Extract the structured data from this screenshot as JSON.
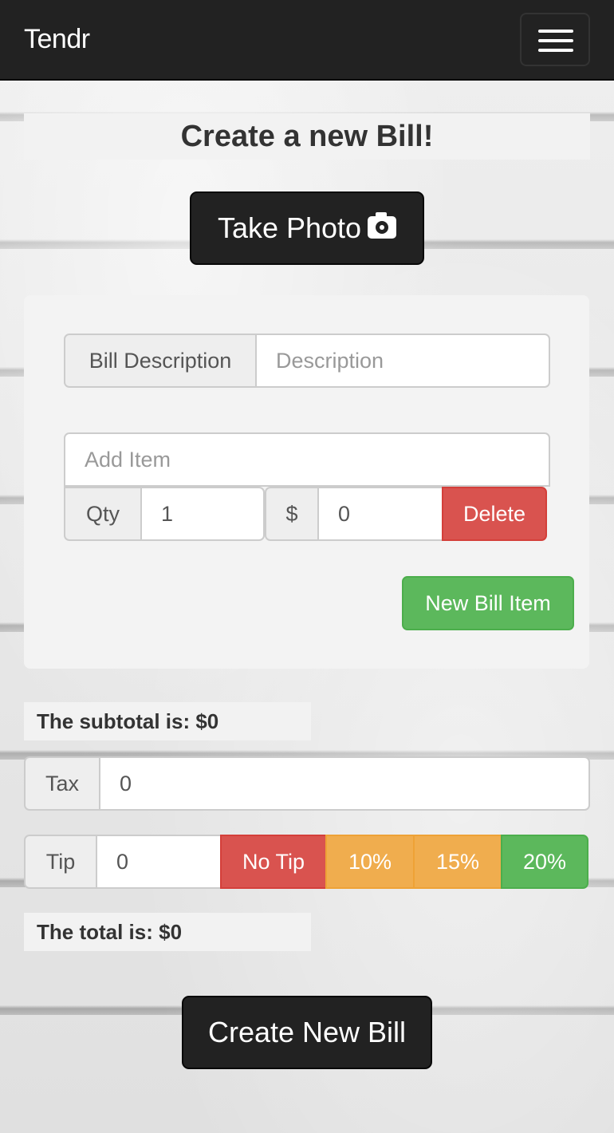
{
  "navbar": {
    "brand": "Tendr",
    "menu_icon": "hamburger-menu-icon"
  },
  "page": {
    "title": "Create a new Bill!"
  },
  "take_photo": {
    "label": "Take Photo",
    "icon": "camera-icon"
  },
  "bill_form": {
    "description_label": "Bill Description",
    "description_placeholder": "Description",
    "description_value": "",
    "item": {
      "name_placeholder": "Add Item",
      "name_value": "",
      "qty_label": "Qty",
      "qty_value": "1",
      "price_label": "$",
      "price_value": "0",
      "delete_label": "Delete"
    },
    "new_item_label": "New Bill Item"
  },
  "summary": {
    "subtotal_text": "The subtotal is: $0",
    "tax_label": "Tax",
    "tax_value": "0",
    "tip_label": "Tip",
    "tip_value": "0",
    "tip_options": [
      "No Tip",
      "10%",
      "15%",
      "20%"
    ],
    "total_text": "The total is: $0"
  },
  "create_button": {
    "label": "Create New Bill"
  },
  "colors": {
    "navbar": "#222222",
    "danger": "#d9534f",
    "warning": "#f0ad4e",
    "success": "#5cb85c"
  }
}
